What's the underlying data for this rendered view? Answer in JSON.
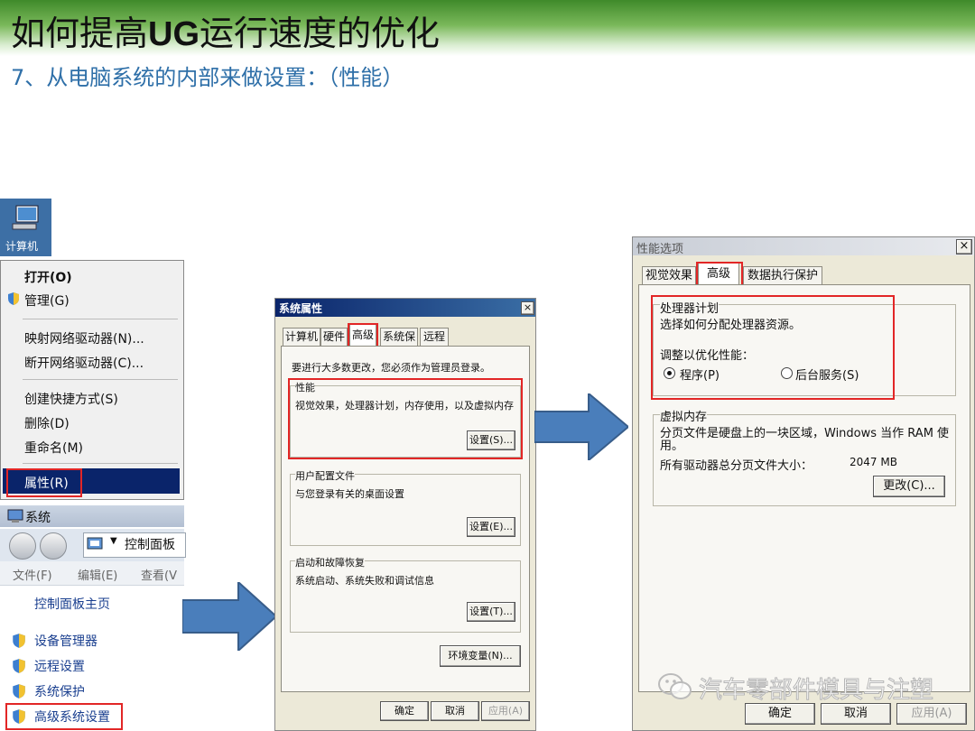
{
  "slide": {
    "title_a": "如何提高",
    "title_b": "UG",
    "title_c": "运行速度的优化",
    "subtitle": "7、从电脑系统的内部来做设置：（性能）"
  },
  "desktop": {
    "computer_label": "计算机"
  },
  "context_menu": {
    "items": [
      "打开(O)",
      "管理(G)",
      "映射网络驱动器(N)...",
      "断开网络驱动器(C)...",
      "创建快捷方式(S)",
      "删除(D)",
      "重命名(M)",
      "属性(R)"
    ]
  },
  "system_window": {
    "title": "系统",
    "address": "控制面板",
    "menu": [
      "文件(F)",
      "编辑(E)",
      "查看(V"
    ],
    "home_link": "控制面板主页",
    "links": [
      "设备管理器",
      "远程设置",
      "系统保护",
      "高级系统设置"
    ]
  },
  "sysprops": {
    "title": "系统属性",
    "tabs": [
      "计算机名",
      "硬件",
      "高级",
      "系统保护",
      "远程"
    ],
    "admin_note": "要进行大多数更改，您必须作为管理员登录。",
    "performance_title": "性能",
    "performance_desc": "视觉效果，处理器计划，内存使用，以及虚拟内存",
    "settings_s": "设置(S)...",
    "profile_title": "用户配置文件",
    "profile_desc": "与您登录有关的桌面设置",
    "settings_e": "设置(E)...",
    "startup_title": "启动和故障恢复",
    "startup_desc": "系统启动、系统失败和调试信息",
    "settings_t": "设置(T)...",
    "env_button": "环境变量(N)...",
    "ok": "确定",
    "cancel": "取消",
    "apply": "应用(A)"
  },
  "perfopts": {
    "title": "性能选项",
    "close": "×",
    "tabs": [
      "视觉效果",
      "高级",
      "数据执行保护"
    ],
    "cpu_title": "处理器计划",
    "cpu_desc": "选择如何分配处理器资源。",
    "optimize_label": "调整以优化性能：",
    "radio_programs": "程序(P)",
    "radio_services": "后台服务(S)",
    "vm_title": "虚拟内存",
    "vm_desc_1": "分页文件是硬盘上的一块区域，Windows 当作 RAM 使",
    "vm_desc_2": "用。",
    "vm_total_label": "所有驱动器总分页文件大小：",
    "vm_total_value": "2047 MB",
    "change_button": "更改(C)...",
    "ok": "确定",
    "cancel": "取消",
    "apply": "应用(A)"
  },
  "watermark": "汽车零部件模具与注塑",
  "colors": {
    "accent_blue": "#4a7ebb",
    "highlight_red": "#e22626",
    "title_green": "#3f8a2a",
    "selection_navy": "#0a246a",
    "subtitle_blue": "#2e6fa8"
  }
}
